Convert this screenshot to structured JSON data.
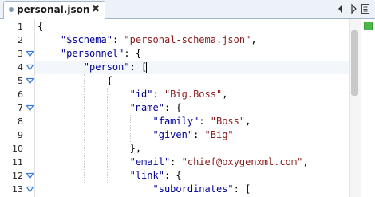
{
  "tab": {
    "title": "personal.json",
    "close_glyph": "✖"
  },
  "tab_nav": {
    "prev_icon": "triangle-left-icon",
    "next_icon": "triangle-right-icon",
    "list_icon": "editor-list-icon"
  },
  "validation": {
    "status": "valid",
    "color": "#4cb848"
  },
  "colors": {
    "key": "#000096",
    "string": "#8b1a1a",
    "fold_marker": "#3a7bd5"
  },
  "caret": {
    "line": 4
  },
  "lines": [
    {
      "n": "1",
      "fold": false,
      "segments": [
        {
          "t": "{",
          "c": "p"
        }
      ]
    },
    {
      "n": "2",
      "fold": false,
      "segments": [
        {
          "t": "    ",
          "c": "p"
        },
        {
          "t": "\"$schema\"",
          "c": "k"
        },
        {
          "t": ": ",
          "c": "p"
        },
        {
          "t": "\"personal-schema.json\"",
          "c": "s"
        },
        {
          "t": ",",
          "c": "p"
        }
      ]
    },
    {
      "n": "3",
      "fold": true,
      "segments": [
        {
          "t": "    ",
          "c": "p"
        },
        {
          "t": "\"personnel\"",
          "c": "k"
        },
        {
          "t": ": {",
          "c": "p"
        }
      ]
    },
    {
      "n": "4",
      "fold": true,
      "segments": [
        {
          "t": "        ",
          "c": "p"
        },
        {
          "t": "\"person\"",
          "c": "k"
        },
        {
          "t": ": [",
          "c": "p"
        }
      ]
    },
    {
      "n": "5",
      "fold": true,
      "segments": [
        {
          "t": "            {",
          "c": "p"
        }
      ]
    },
    {
      "n": "6",
      "fold": false,
      "segments": [
        {
          "t": "                ",
          "c": "p"
        },
        {
          "t": "\"id\"",
          "c": "k"
        },
        {
          "t": ": ",
          "c": "p"
        },
        {
          "t": "\"Big.Boss\"",
          "c": "s"
        },
        {
          "t": ",",
          "c": "p"
        }
      ]
    },
    {
      "n": "7",
      "fold": true,
      "segments": [
        {
          "t": "                ",
          "c": "p"
        },
        {
          "t": "\"name\"",
          "c": "k"
        },
        {
          "t": ": {",
          "c": "p"
        }
      ]
    },
    {
      "n": "8",
      "fold": false,
      "segments": [
        {
          "t": "                    ",
          "c": "p"
        },
        {
          "t": "\"family\"",
          "c": "k"
        },
        {
          "t": ": ",
          "c": "p"
        },
        {
          "t": "\"Boss\"",
          "c": "s"
        },
        {
          "t": ",",
          "c": "p"
        }
      ]
    },
    {
      "n": "9",
      "fold": false,
      "segments": [
        {
          "t": "                    ",
          "c": "p"
        },
        {
          "t": "\"given\"",
          "c": "k"
        },
        {
          "t": ": ",
          "c": "p"
        },
        {
          "t": "\"Big\"",
          "c": "s"
        }
      ]
    },
    {
      "n": "10",
      "fold": false,
      "segments": [
        {
          "t": "                },",
          "c": "p"
        }
      ]
    },
    {
      "n": "11",
      "fold": false,
      "segments": [
        {
          "t": "                ",
          "c": "p"
        },
        {
          "t": "\"email\"",
          "c": "k"
        },
        {
          "t": ": ",
          "c": "p"
        },
        {
          "t": "\"chief@oxygenxml.com\"",
          "c": "s"
        },
        {
          "t": ",",
          "c": "p"
        }
      ]
    },
    {
      "n": "12",
      "fold": true,
      "segments": [
        {
          "t": "                ",
          "c": "p"
        },
        {
          "t": "\"link\"",
          "c": "k"
        },
        {
          "t": ": {",
          "c": "p"
        }
      ]
    },
    {
      "n": "13",
      "fold": true,
      "segments": [
        {
          "t": "                    ",
          "c": "p"
        },
        {
          "t": "\"subordinates\"",
          "c": "k"
        },
        {
          "t": ": [",
          "c": "p"
        }
      ]
    }
  ]
}
